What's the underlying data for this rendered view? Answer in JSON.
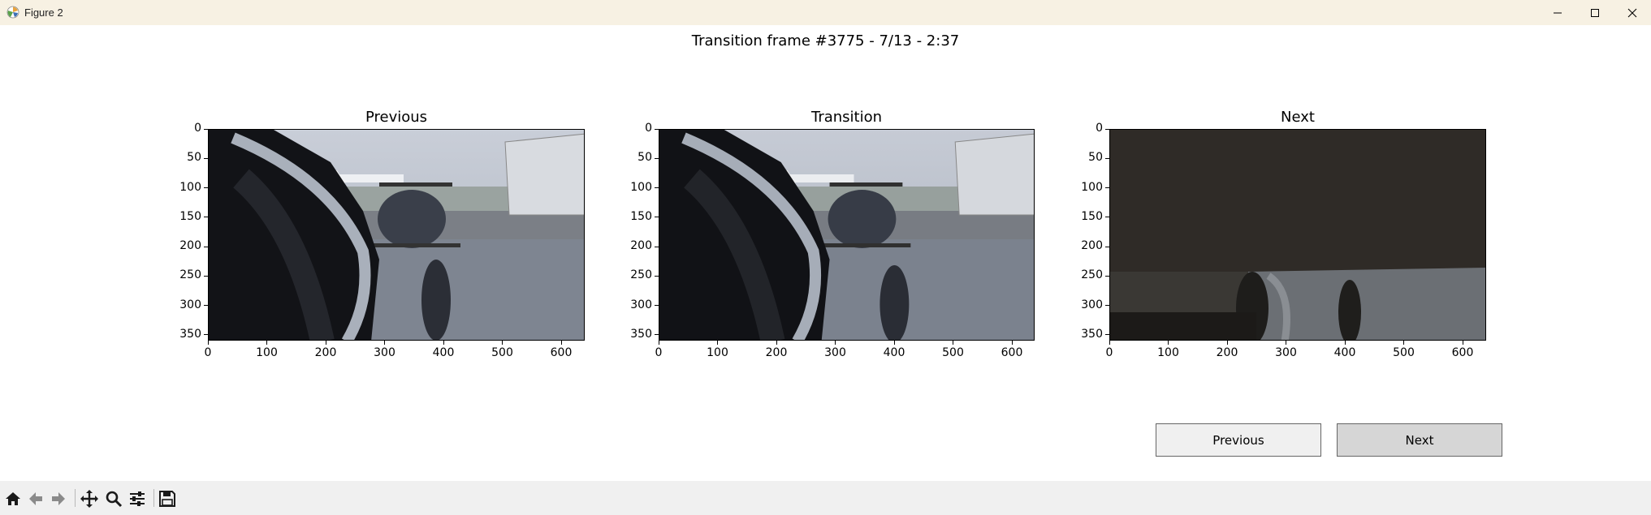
{
  "window": {
    "title": "Figure 2",
    "app_icon": "matplotlib-icon",
    "controls": [
      "minimize-icon",
      "maximize-icon",
      "close-icon"
    ]
  },
  "figure": {
    "suptitle": "Transition frame #3775 - 7/13 - 2:37"
  },
  "axes": [
    {
      "title": "Previous",
      "image": "video-frame-previous"
    },
    {
      "title": "Transition",
      "image": "video-frame-transition"
    },
    {
      "title": "Next",
      "image": "video-frame-next-dark"
    }
  ],
  "ticks": {
    "y": [
      "0",
      "50",
      "100",
      "150",
      "200",
      "250",
      "300",
      "350"
    ],
    "x": [
      "0",
      "100",
      "200",
      "300",
      "400",
      "500",
      "600"
    ]
  },
  "buttons": {
    "previous": "Previous",
    "next": "Next"
  },
  "toolbar": {
    "tools": [
      "home-icon",
      "back-arrow-icon",
      "forward-arrow-icon",
      "pan-icon",
      "zoom-icon",
      "configure-subplots-icon",
      "save-icon"
    ]
  },
  "colors": {
    "titlebar": "#f7f1e3",
    "toolbar": "#f0f0f0",
    "button_previous": "#f0f0f0",
    "button_next": "#d6d6d6"
  }
}
